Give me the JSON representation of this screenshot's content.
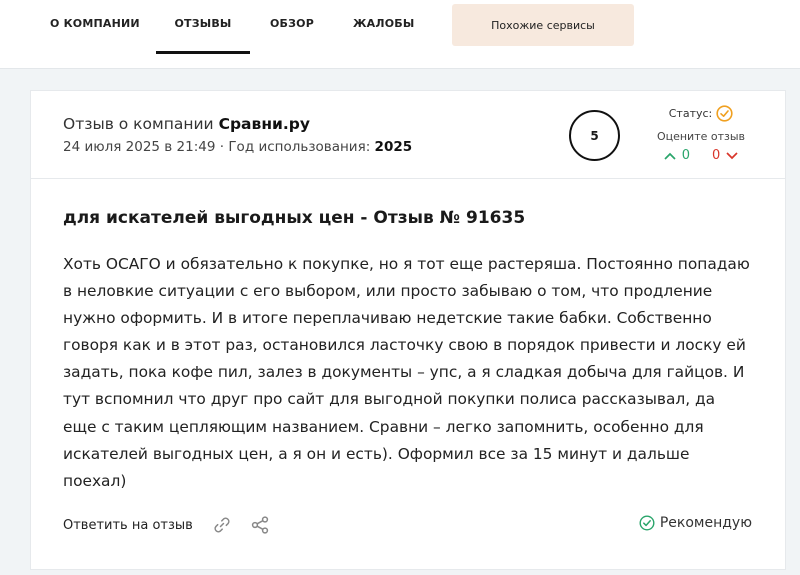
{
  "nav": {
    "items": [
      {
        "label": "О компании",
        "active": false
      },
      {
        "label": "Отзывы",
        "active": true
      },
      {
        "label": "Обзор",
        "active": false
      },
      {
        "label": "Жалобы",
        "active": false
      }
    ],
    "similar_button": "Похожие сервисы"
  },
  "review": {
    "company_prefix": "Отзыв о компании",
    "company_name": "Сравни.ру",
    "date": "24 июля 2025 в 21:49",
    "separator": " · ",
    "usage_label": "Год использования:",
    "usage_year": "2025",
    "rating": "5",
    "status_label": "Статус:",
    "rate_prompt": "Оцените отзыв",
    "votes_up": "0",
    "votes_down": "0",
    "title": "для искателей выгодных цен - Отзыв № 91635",
    "body": "Хоть ОСАГО и обязательно к покупке, но я тот еще растеряша. Постоянно попадаю в неловкие ситуации с его выбором, или просто забываю о том, что продление нужно оформить. И в итоге переплачиваю недетские такие бабки. Собственно говоря как и в этот раз, остановился ласточку свою в порядок привести и лоску ей задать, пока кофе пил, залез в документы – упс, а я сладкая добыча для гайцов. И тут вспомнил что друг про сайт для выгодной покупки полиса рассказывал, да еще с таким цепляющим названием. Сравни – легко запомнить, особенно для искателей выгодных цен, а я он и есть). Оформил все за 15 минут и дальше поехал)",
    "reply_label": "Ответить на отзыв",
    "recommend_label": "Рекомендую"
  },
  "colors": {
    "accent_orange": "#f0a020",
    "up_green": "#2aa56b",
    "down_red": "#d9362b",
    "recommend_green": "#2aa56b"
  }
}
